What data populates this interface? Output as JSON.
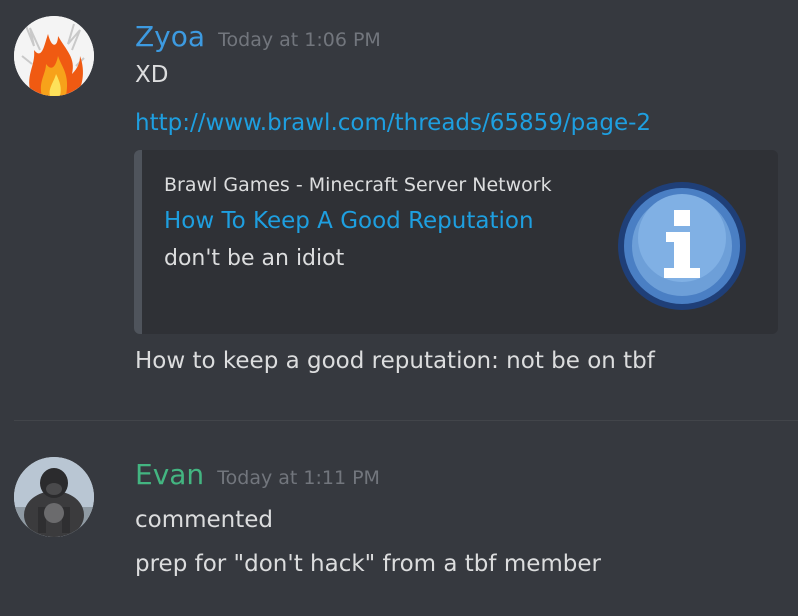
{
  "messages": [
    {
      "username": "Zyoa",
      "username_color": "#3d9ae0",
      "timestamp": "Today at 1:06 PM",
      "avatar_icon": "flame-avatar",
      "lines": [
        "XD"
      ],
      "link": "http://www.brawl.com/threads/65859/page-2",
      "embed": {
        "provider": "Brawl Games - Minecraft Server Network",
        "title": "How To Keep A Good Reputation",
        "description": "don't be an idiot",
        "thumbnail_icon": "info-icon"
      },
      "after_embed": "How to keep a good reputation: not be on tbf"
    },
    {
      "username": "Evan",
      "username_color": "#43b581",
      "timestamp": "Today at 1:11 PM",
      "avatar_icon": "gorilla-avatar",
      "lines": [
        "commented",
        "prep for \"don't hack\" from a tbf member"
      ]
    }
  ]
}
